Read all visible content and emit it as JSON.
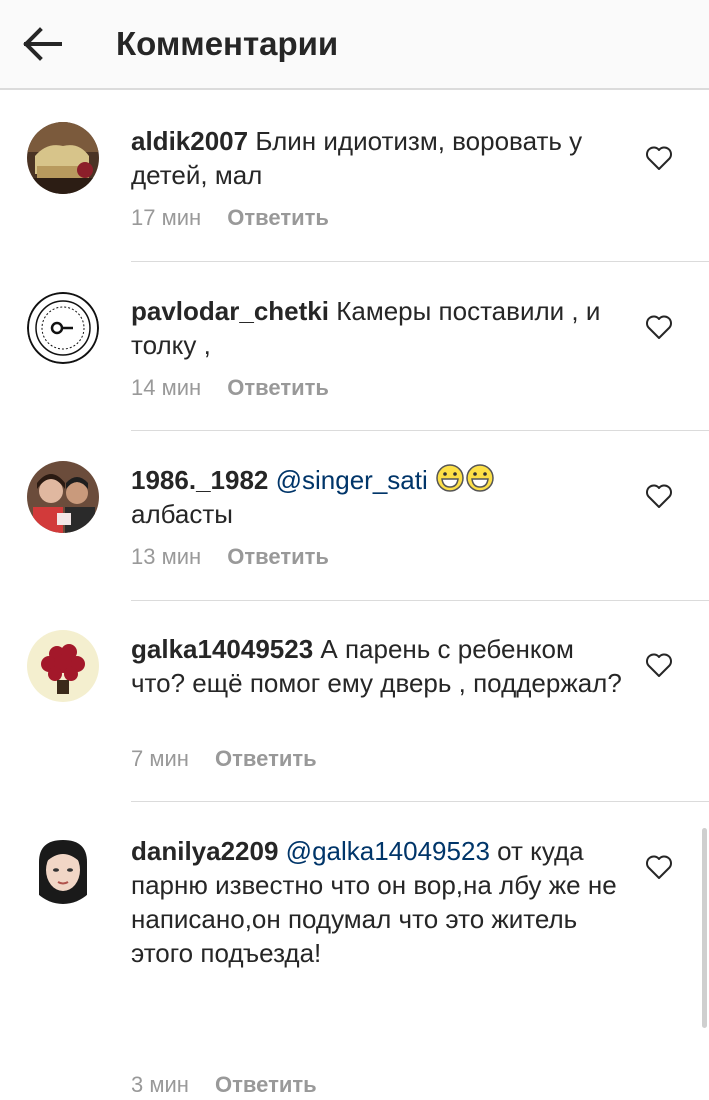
{
  "header": {
    "title": "Комментарии"
  },
  "comments": [
    {
      "username": "aldik2007",
      "mention": "",
      "text": "Блин идиотизм, воровать у детей, мал",
      "time": "17 мин",
      "reply": "Ответить"
    },
    {
      "username": "pavlodar_chetki",
      "mention": "",
      "text": "Камеры поставили , и толку ,",
      "time": "14 мин",
      "reply": "Ответить"
    },
    {
      "username": "1986._1982",
      "mention": "@singer_sati",
      "text": "албасты",
      "emoji": [
        "grinning-face-icon",
        "grinning-face-icon"
      ],
      "time": "13 мин",
      "reply": "Ответить"
    },
    {
      "username": "galka14049523",
      "mention": "",
      "text": "А парень с ребенком что? ещё помог ему дверь , поддержал?",
      "time": "7 мин",
      "reply": "Ответить"
    },
    {
      "username": "danilya2209",
      "mention": "@galka14049523",
      "text": "от куда парню известно что он вор,на лбу же не написано,он подумал что это житель этого подъезда!",
      "time": "3 мин",
      "reply": "Ответить"
    }
  ],
  "colors": {
    "text": "#262626",
    "mention": "#003569",
    "meta": "#999999",
    "divider": "#dbdbdb",
    "header_bg": "#fafafa"
  },
  "icons": {
    "back": "arrow-left-icon",
    "like": "heart-outline-icon"
  }
}
